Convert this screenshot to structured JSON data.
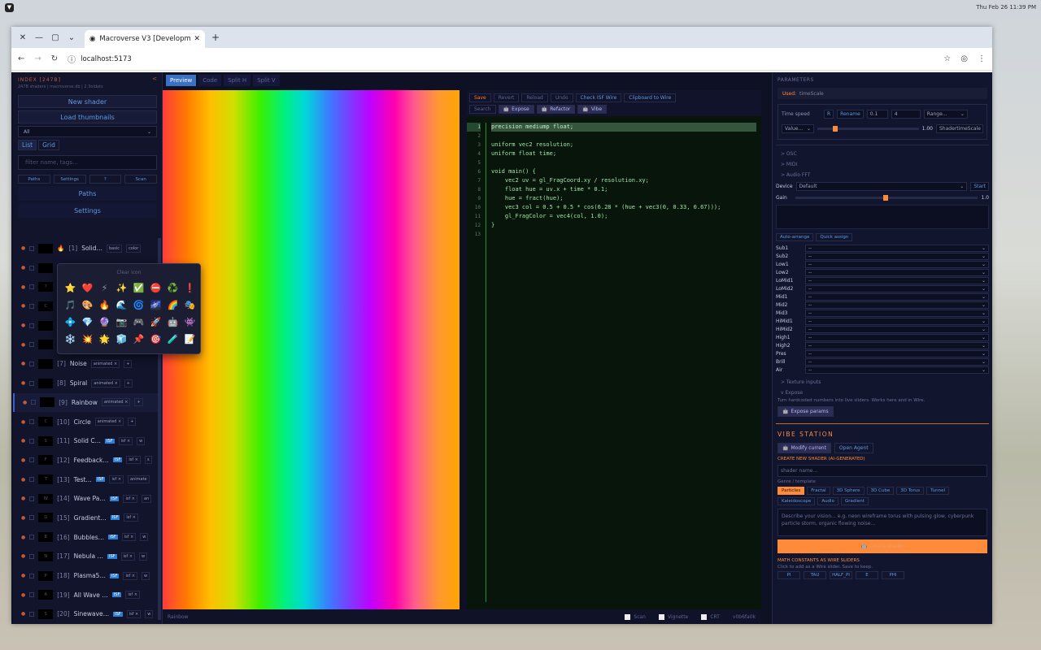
{
  "os": {
    "datetime": "Thu Feb 26   11:39 PM"
  },
  "browser": {
    "tab_title": "Macroverse V3 [Developm",
    "url": "localhost:5173"
  },
  "left": {
    "header": "INDEX [247B]",
    "collapse": "<",
    "sub": "247B shaders | macroverse.db | 2.3oldats",
    "new_shader": "New shader",
    "load_thumbnails": "Load thumbnails",
    "filter_select": "All",
    "view_list": "List",
    "view_grid": "Grid",
    "filter_placeholder": "filter name, tags...",
    "small_buttons": [
      "Paths",
      "Settings",
      "?",
      "Scan"
    ],
    "paths": "Paths",
    "settings": "Settings",
    "items": [
      {
        "idx": "[1]",
        "name": "Solid…",
        "tags": [
          "basic",
          "color"
        ],
        "isf": false,
        "thumb": "",
        "emoji": "🔥"
      },
      {
        "idx": "",
        "name": "",
        "tags": [],
        "isf": false,
        "thumb": "",
        "emoji": "🎨"
      },
      {
        "idx": "[",
        "name": "",
        "tags": [],
        "isf": false,
        "thumb": "?",
        "emoji": ""
      },
      {
        "idx": "",
        "name": "",
        "tags": [],
        "isf": false,
        "thumb": "C",
        "emoji": ""
      },
      {
        "idx": "",
        "name": "",
        "tags": [],
        "isf": false,
        "thumb": "",
        "emoji": ""
      },
      {
        "idx": "",
        "name": "",
        "tags": [],
        "isf": false,
        "thumb": "",
        "emoji": ""
      },
      {
        "idx": "[7]",
        "name": "Noise",
        "tags": [
          "animated ×",
          "+"
        ],
        "isf": false,
        "thumb": "",
        "emoji": ""
      },
      {
        "idx": "[8]",
        "name": "Spiral",
        "tags": [
          "animated ×",
          "+"
        ],
        "isf": false,
        "thumb": "",
        "emoji": ""
      },
      {
        "idx": "[9]",
        "name": "Rainbow",
        "tags": [
          "animated ×",
          "+"
        ],
        "isf": false,
        "thumb": "",
        "emoji": "",
        "active": true
      },
      {
        "idx": "[10]",
        "name": "Circle",
        "tags": [
          "animated ×",
          "+"
        ],
        "isf": false,
        "thumb": "C",
        "emoji": ""
      },
      {
        "idx": "[11]",
        "name": "Solid C…",
        "tags": [
          "isf ×",
          "w"
        ],
        "isf": true,
        "thumb": "S",
        "emoji": ""
      },
      {
        "idx": "[12]",
        "name": "Feedback…",
        "tags": [
          "isf ×",
          "s"
        ],
        "isf": true,
        "thumb": "F",
        "emoji": ""
      },
      {
        "idx": "[13]",
        "name": "Test…",
        "tags": [
          "isf ×",
          "animate"
        ],
        "isf": true,
        "thumb": "T",
        "emoji": ""
      },
      {
        "idx": "[14]",
        "name": "Wave Pa…",
        "tags": [
          "isf ×",
          "an"
        ],
        "isf": true,
        "thumb": "W",
        "emoji": ""
      },
      {
        "idx": "[15]",
        "name": "Gradient…",
        "tags": [
          "isf ×",
          ""
        ],
        "isf": true,
        "thumb": "G",
        "emoji": ""
      },
      {
        "idx": "[16]",
        "name": "Bubbles…",
        "tags": [
          "isf ×",
          "w"
        ],
        "isf": true,
        "thumb": "B",
        "emoji": ""
      },
      {
        "idx": "[17]",
        "name": "Nebula …",
        "tags": [
          "isf ×",
          "w"
        ],
        "isf": true,
        "thumb": "N",
        "emoji": ""
      },
      {
        "idx": "[18]",
        "name": "Plasma5…",
        "tags": [
          "isf ×",
          "w"
        ],
        "isf": true,
        "thumb": "P",
        "emoji": ""
      },
      {
        "idx": "[19]",
        "name": "All Wave …",
        "tags": [
          "isf ×"
        ],
        "isf": true,
        "thumb": "A",
        "emoji": ""
      },
      {
        "idx": "[20]",
        "name": "Sinewave…",
        "tags": [
          "isf ×",
          "w"
        ],
        "isf": true,
        "thumb": "S",
        "emoji": ""
      }
    ]
  },
  "popup": {
    "clear": "Clear icon",
    "emojis": [
      "⭐",
      "❤️",
      "⚡",
      "✨",
      "✅",
      "⛔",
      "♻️",
      "❗",
      "🎵",
      "🎨",
      "🔥",
      "🌊",
      "🌀",
      "🌌",
      "🌈",
      "🎭",
      "💠",
      "💎",
      "🔮",
      "📷",
      "🎮",
      "🚀",
      "🤖",
      "👾",
      "❄️",
      "💥",
      "🌟",
      "🧊",
      "📌",
      "🎯",
      "🧪",
      "📝"
    ]
  },
  "preview": {
    "tabs": [
      "Preview",
      "Code",
      "Split H",
      "Split V"
    ],
    "status_name": "Rainbow",
    "toggles": [
      "Scan",
      "Vignette",
      "CRT"
    ],
    "hash": "v0b6fa0k"
  },
  "editor": {
    "toolbar1": [
      "Save",
      "Revert",
      "Reload",
      "Undo",
      "Check ISF Wire",
      "Clipboard to Wire"
    ],
    "toolbar2": [
      "Search",
      "Expose",
      "Refactor",
      "Vibe"
    ],
    "line_numbers": [
      "1",
      "2",
      "3",
      "4",
      "5",
      "6",
      "7",
      "8",
      "9",
      "10",
      "11",
      "12",
      "13"
    ],
    "code": [
      "precision mediump float;",
      "",
      "uniform vec2 resolution;",
      "uniform float time;",
      "",
      "void main() {",
      "    vec2 uv = gl_FragCoord.xy / resolution.xy;",
      "    float hue = uv.x + time * 0.1;",
      "    hue = fract(hue);",
      "    vec3 col = 0.5 + 0.5 * cos(6.28 * (hue + vec3(0, 0.33, 0.67)));",
      "    gl_FragColor = vec4(col, 1.0);",
      "}",
      ""
    ]
  },
  "right": {
    "header": "PARAMETERS",
    "used_label": "Used:",
    "used_value": "timeScale",
    "time_speed": "Time speed",
    "r": "R",
    "rename": "Rename",
    "min": "0.1",
    "max": "4",
    "range": "Range...",
    "value_mode": "Value...",
    "value": "1.00",
    "shader_param": "ShadertimeScale",
    "osc": "> OSC",
    "midi": "> MIDI",
    "audio": "> Audio FFT",
    "device_label": "Device",
    "device_value": "Default",
    "start": "Start",
    "gain_label": "Gain",
    "gain_value": "1.0",
    "auto_arrange": "Auto-arrange",
    "quick_assign": "Quick assign",
    "bands": [
      "Sub1",
      "Sub2",
      "Low1",
      "Low2",
      "LoMid1",
      "LoMid2",
      "Mid1",
      "Mid2",
      "Mid3",
      "HiMid1",
      "HiMid2",
      "High1",
      "High2",
      "Pres",
      "Brill",
      "Air"
    ],
    "band_value": "--",
    "texture_inputs": "> Texture inputs",
    "expose": "v Expose",
    "expose_desc": "Turn hardcoded numbers into live sliders. Works here and in Wire.",
    "expose_params": "Expose params",
    "vibe_title": "VIBE STATION",
    "modify_current": "Modify current",
    "open_agent": "Open Agent",
    "create_new": "CREATE NEW SHADER (AI-GENERATED)",
    "shader_name_placeholder": "shader name...",
    "genre_label": "Genre / template",
    "genres": [
      "Particles",
      "Fractal",
      "3D Sphere",
      "3D Cube",
      "3D Torus",
      "Tunnel",
      "Kaleidoscope",
      "Audio",
      "Gradient"
    ],
    "vision_placeholder": "Describe your vision... e.g. neon wireframe torus with pulsing glow, cyberpunk particle storm, organic flowing noise...",
    "create_button": "Create shader",
    "math_title": "MATH CONSTANTS AS WIRE SLIDERS",
    "math_desc": "Click to add as a Wire slider. Save to keep.",
    "constants": [
      "PI",
      "TAU",
      "HALF_PI",
      "E",
      "PHI"
    ]
  }
}
